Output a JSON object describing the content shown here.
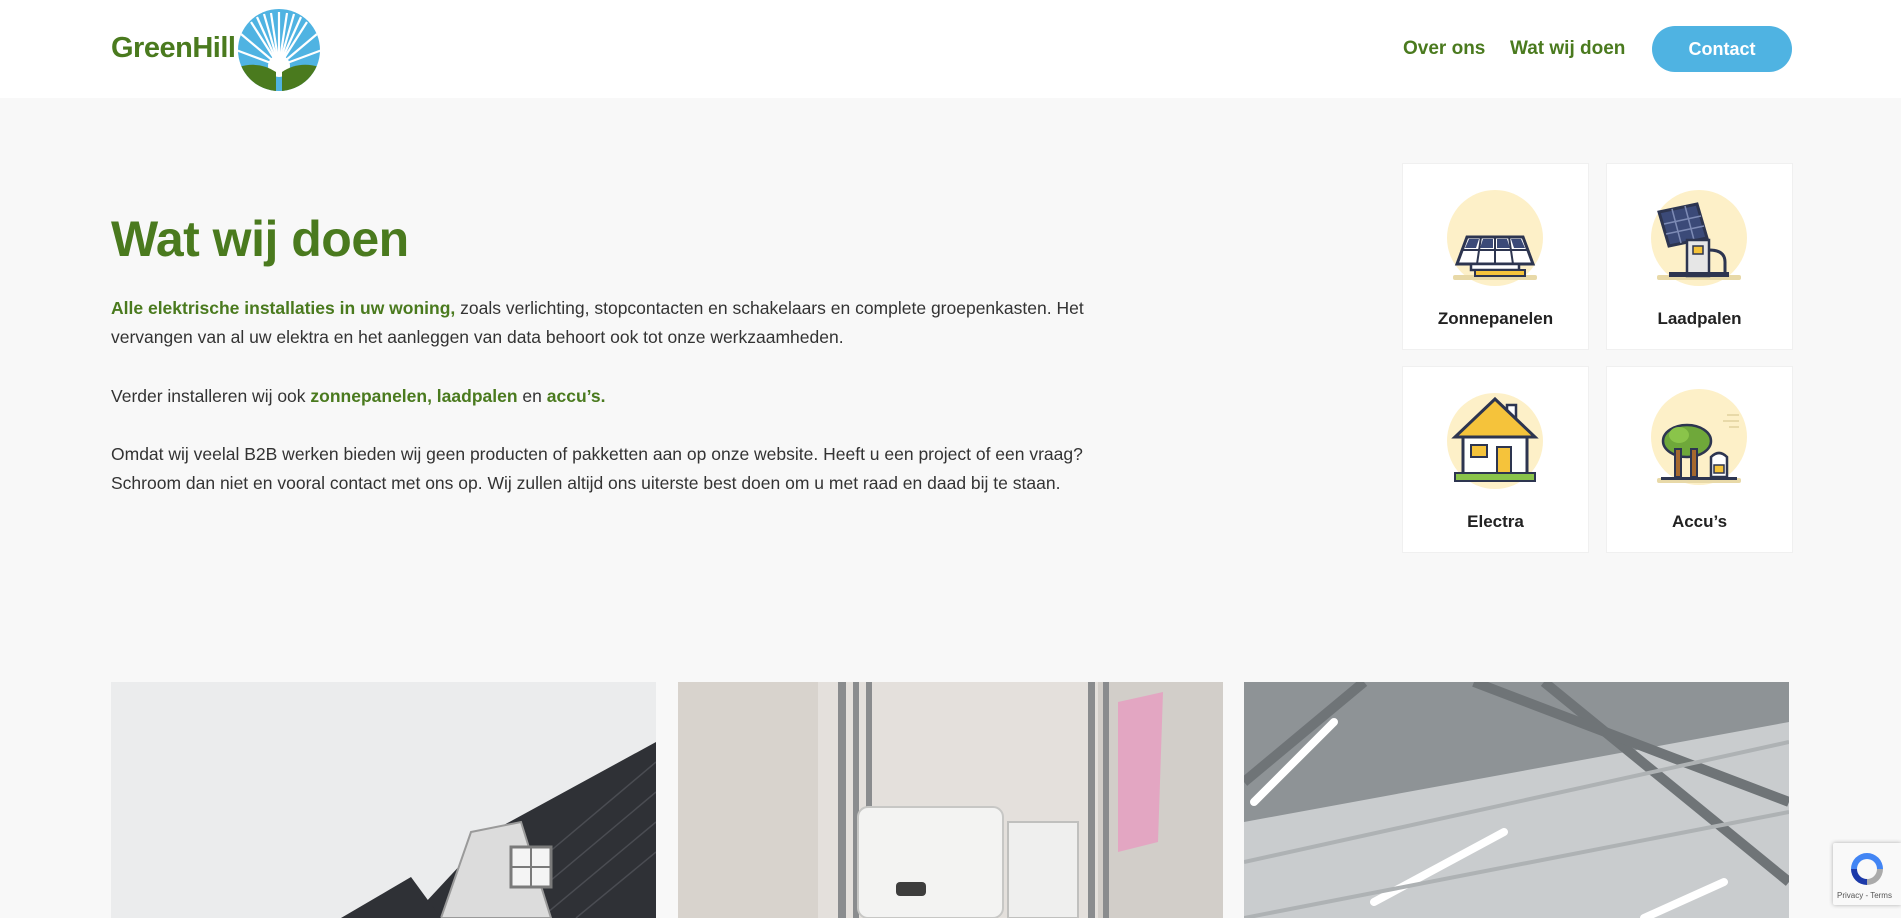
{
  "header": {
    "logo_text": "GreenHill",
    "nav": [
      {
        "label": "Over ons"
      },
      {
        "label": "Wat wij doen"
      }
    ],
    "contact_label": "Contact"
  },
  "main": {
    "title": "Wat wij doen",
    "p1_highlight": "Alle elektrische installaties in uw woning,",
    "p1_rest": " zoals verlichting, stopcontacten en schakelaars en complete groepenkasten. Het vervangen van al uw elektra en het aanleggen van data behoort ook tot onze werkzaamheden.",
    "p2_start": "Verder installeren wij ook ",
    "p2_hl1": "zonnepanelen, laadpalen",
    "p2_mid": " en ",
    "p2_hl2": "accu’s.",
    "p3": "Omdat wij veelal B2B werken bieden wij geen producten of pakketten aan op onze website. Heeft u een project of een vraag? Schroom dan niet en vooral contact met ons op. Wij zullen altijd ons uiterste best doen om u met raad en daad bij te staan."
  },
  "services": [
    {
      "label": "Zonnepanelen",
      "icon": "solar-panel-icon"
    },
    {
      "label": "Laadpalen",
      "icon": "charging-station-icon"
    },
    {
      "label": "Electra",
      "icon": "house-icon"
    },
    {
      "label": "Accu’s",
      "icon": "tree-battery-icon"
    }
  ],
  "recaptcha": {
    "text": "Privacy - Terms"
  },
  "colors": {
    "brand_green": "#4a7a1e",
    "accent_blue": "#4fb3e2",
    "background": "#f8f8f8"
  }
}
